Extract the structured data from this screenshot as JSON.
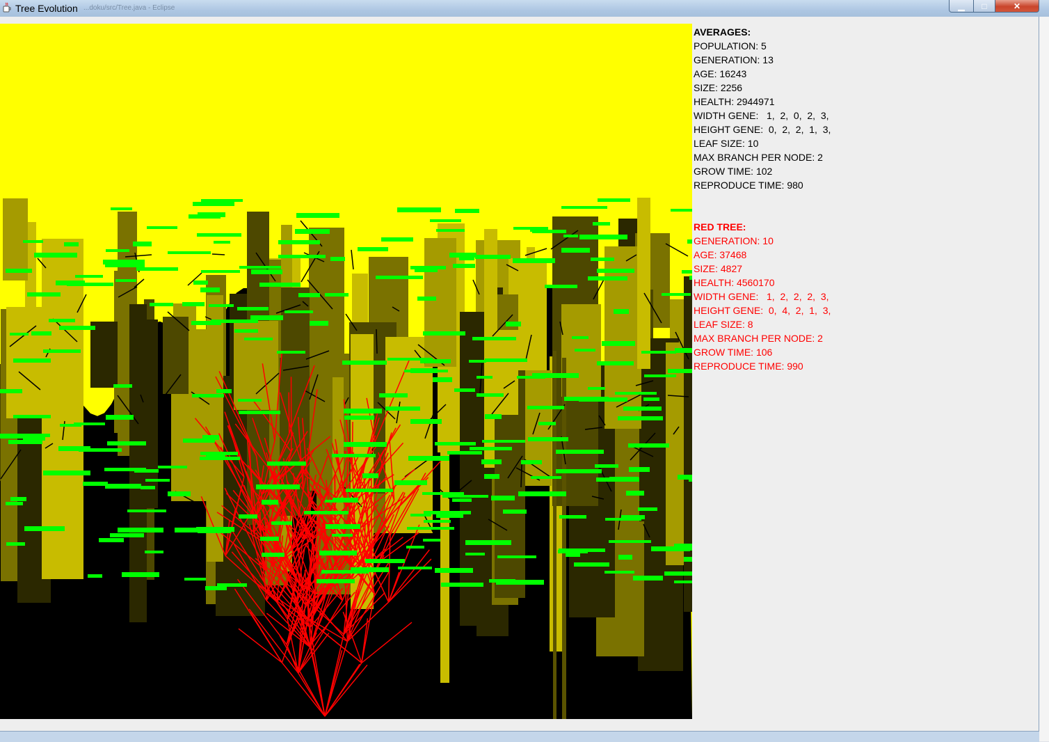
{
  "window": {
    "title": "Tree Evolution",
    "background_title": "...doku/src/Tree.java - Eclipse",
    "app_icon": "java-cup-icon",
    "buttons": {
      "minimize": "minimize-icon",
      "maximize": "maximize-icon",
      "close": "close-icon"
    }
  },
  "simulation": {
    "sky_color": "#ffff00",
    "ground_color": "#000000",
    "leaf_color": "#00ff00",
    "branch_color": "#000000",
    "highlight_branch_color": "#ff0000",
    "trunk_shade_color": "#c8bc00"
  },
  "averages": {
    "header": "AVERAGES:",
    "population": "POPULATION: 5",
    "generation": "GENERATION: 13",
    "age": "AGE: 16243",
    "size": "SIZE: 2256",
    "health": "HEALTH: 2944971",
    "width_gene": "WIDTH GENE:   1,  2,  0,  2,  3,",
    "height_gene": "HEIGHT GENE:  0,  2,  2,  1,  3,",
    "leaf_size": "LEAF SIZE: 10",
    "max_branch": "MAX BRANCH PER NODE: 2",
    "grow_time": "GROW TIME: 102",
    "reproduce_time": "REPRODUCE TIME: 980"
  },
  "red_tree": {
    "header": "RED TREE:",
    "generation": "GENERATION: 10",
    "age": "AGE: 37468",
    "size": "SIZE: 4827",
    "health": "HEALTH: 4560170",
    "width_gene": "WIDTH GENE:   1,  2,  2,  2,  3,",
    "height_gene": "HEIGHT GENE:  0,  4,  2,  1,  3,",
    "leaf_size": "LEAF SIZE: 8",
    "max_branch": "MAX BRANCH PER NODE: 2",
    "grow_time": "GROW TIME: 106",
    "reproduce_time": "REPRODUCE TIME: 990"
  }
}
